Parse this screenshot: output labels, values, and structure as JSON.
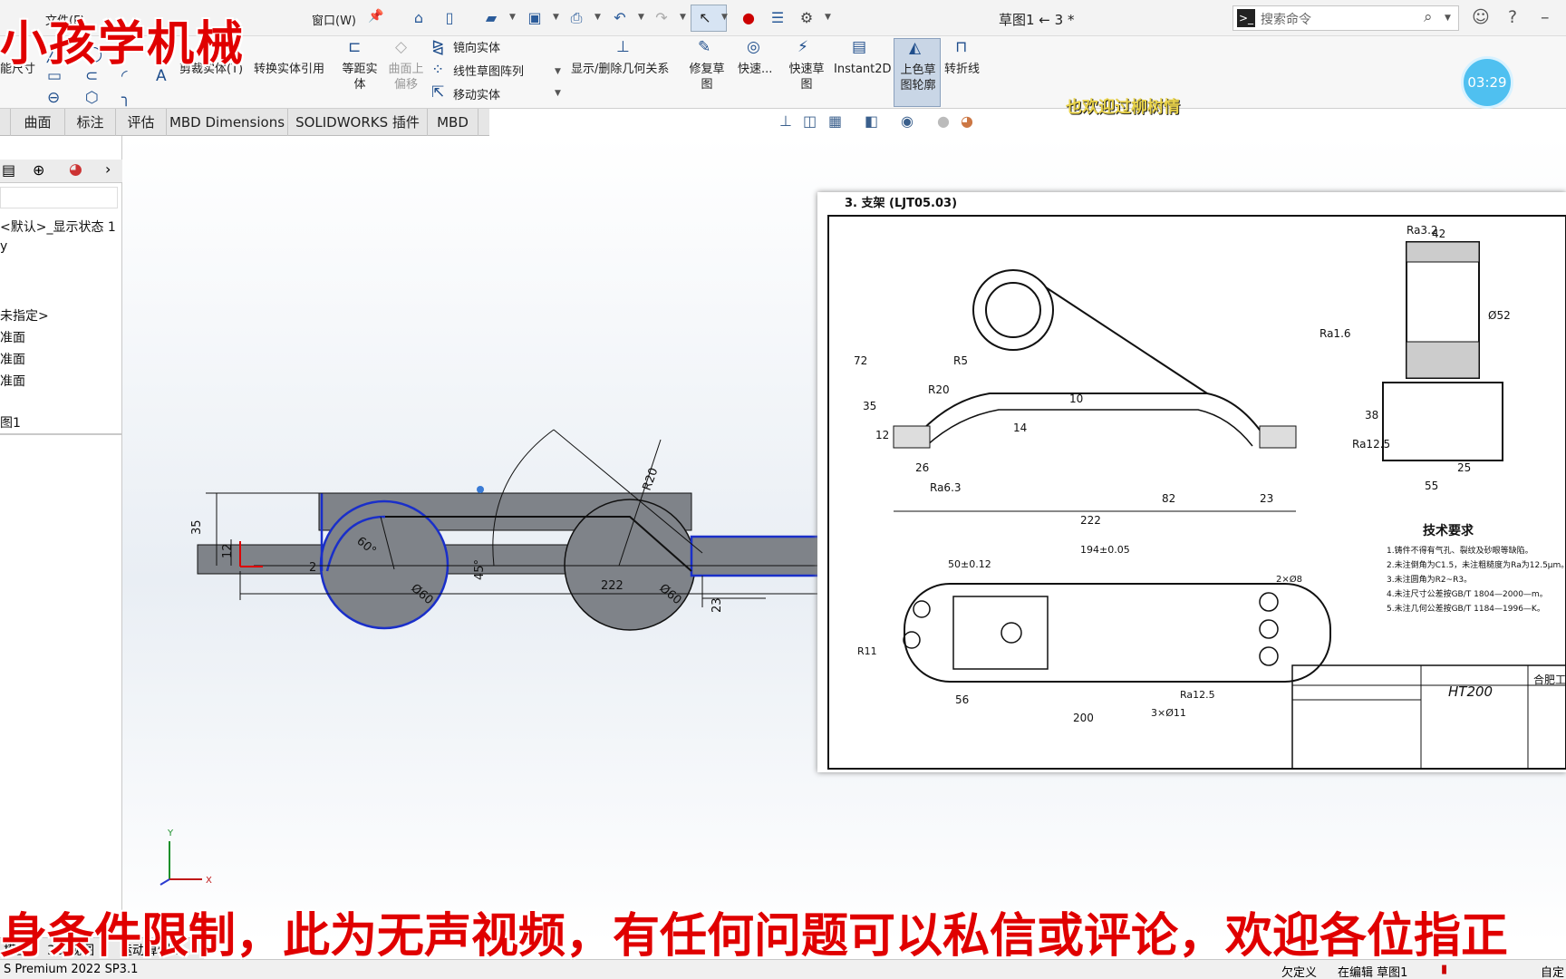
{
  "overlay": {
    "title": "小孩学机械",
    "subtitle": "身条件限制，此为无声视频，有任何问题可以私信或评论，欢迎各位指正",
    "mid_caption": "也欢迎过柳树情",
    "timer": "03:29"
  },
  "menu": {
    "file": "文件(F)",
    "window": "窗口(W)",
    "doc_title": "草图1 ← 3 *",
    "search_placeholder": "搜索命令"
  },
  "toolbar": {
    "smart_dim": "能尺寸",
    "trim": "剪裁实体(T)",
    "convert": "转换实体引用",
    "offset": "等距实体",
    "surface_offset": "曲面上偏移",
    "mirror": "镜向实体",
    "linear_pattern": "线性草图阵列",
    "move": "移动实体",
    "show_relations": "显示/删除几何关系",
    "repair": "修复草图",
    "quick_snaps": "快速...",
    "rapid_sketch": "快速草图",
    "instant2d": "Instant2D",
    "shaded_contours": "上色草图轮廓",
    "jog_line": "转折线"
  },
  "tabs": [
    "曲面",
    "标注",
    "评估",
    "MBD Dimensions",
    "SOLIDWORKS 插件",
    "MBD"
  ],
  "tree": [
    "<默认>_显示状态 1",
    "y",
    "未指定>",
    "准面",
    "准面",
    "准面",
    "图1"
  ],
  "bottom_tabs": [
    "模型",
    "3D 视图",
    "运动算例 1"
  ],
  "status": {
    "left": "S Premium 2022 SP3.1",
    "underdefined": "欠定义",
    "editing": "在编辑 草图1",
    "right": "自定"
  },
  "sketch_dims": {
    "d35": "35",
    "d12": "12",
    "d45": "45°",
    "r20": "R20",
    "dia60a": "Ø60",
    "dia60b": "Ø60",
    "d60": "60°",
    "d23": "23",
    "d222": "222",
    "r2": "2"
  },
  "ref": {
    "title": "3. 支架 (LJT05.03)",
    "d222": "222",
    "d82": "82",
    "d23": "23",
    "d26": "26",
    "d14": "14",
    "d10": "10",
    "d72": "72",
    "d35": "35",
    "d12": "12",
    "r5": "R5",
    "r20": "R20",
    "ra63": "Ra6.3",
    "ra32": "Ra3.2",
    "ra16": "Ra1.6",
    "ra125": "Ra12.5",
    "d42": "42",
    "d52": "Ø52",
    "d55": "55",
    "d25": "25",
    "d38": "38",
    "d194": "194±0.05",
    "d50": "50±0.12",
    "d200": "200",
    "d56": "56",
    "r11": "R11",
    "hole3": "3×Ø11",
    "hole2": "2×Ø8",
    "material": "HT200",
    "tech_title": "技术要求",
    "tech1": "1.铸件不得有气孔、裂纹及砂眼等缺陷。",
    "tech2": "2.未注倒角为C1.5，未注粗糙度为Ra为12.5μm。",
    "tech3": "3.未注圆角为R2~R3。",
    "tech4": "4.未注尺寸公差按GB/T 1804—2000—m。",
    "tech5": "5.未注几何公差按GB/T 1184—1996—K。",
    "company": "合肥工"
  }
}
